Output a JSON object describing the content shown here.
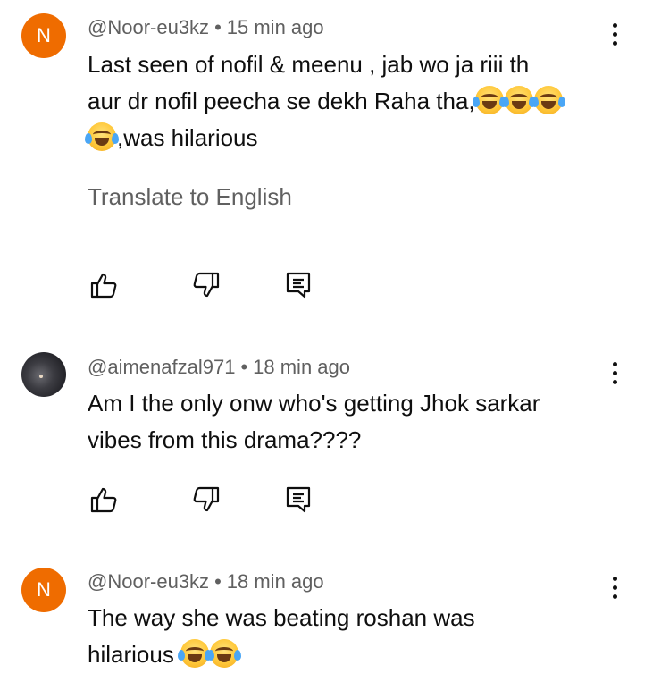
{
  "comments": [
    {
      "avatar_type": "letter",
      "avatar_letter": "N",
      "avatar_color": "#ef6c00",
      "handle": "@Noor-eu3kz",
      "separator": "•",
      "time": "15 min ago",
      "lines": [
        "Last seen of nofil & meenu , jab wo ja riii th",
        "aur dr nofil peecha se dekh Raha tha,",
        ",was hilarious"
      ],
      "translate_label": "Translate to English",
      "emoji_name": "face-with-tears-of-joy"
    },
    {
      "avatar_type": "photo",
      "handle": "@aimenafzal971",
      "separator": "•",
      "time": "18 min ago",
      "lines": [
        "Am I the only onw who's getting Jhok sarkar",
        "vibes from this drama????"
      ]
    },
    {
      "avatar_type": "letter",
      "avatar_letter": "N",
      "avatar_color": "#ef6c00",
      "handle": "@Noor-eu3kz",
      "separator": "•",
      "time": "18 min ago",
      "lines": [
        "The way she was beating roshan was",
        "hilarious"
      ],
      "emoji_name": "face-with-tears-of-joy"
    }
  ],
  "icons": {
    "like": "thumbs-up-icon",
    "dislike": "thumbs-down-icon",
    "reply": "reply-icon",
    "more": "more-vertical-icon"
  },
  "colors": {
    "text_primary": "#0f0f0f",
    "text_secondary": "#606060",
    "avatar_orange": "#ef6c00"
  }
}
